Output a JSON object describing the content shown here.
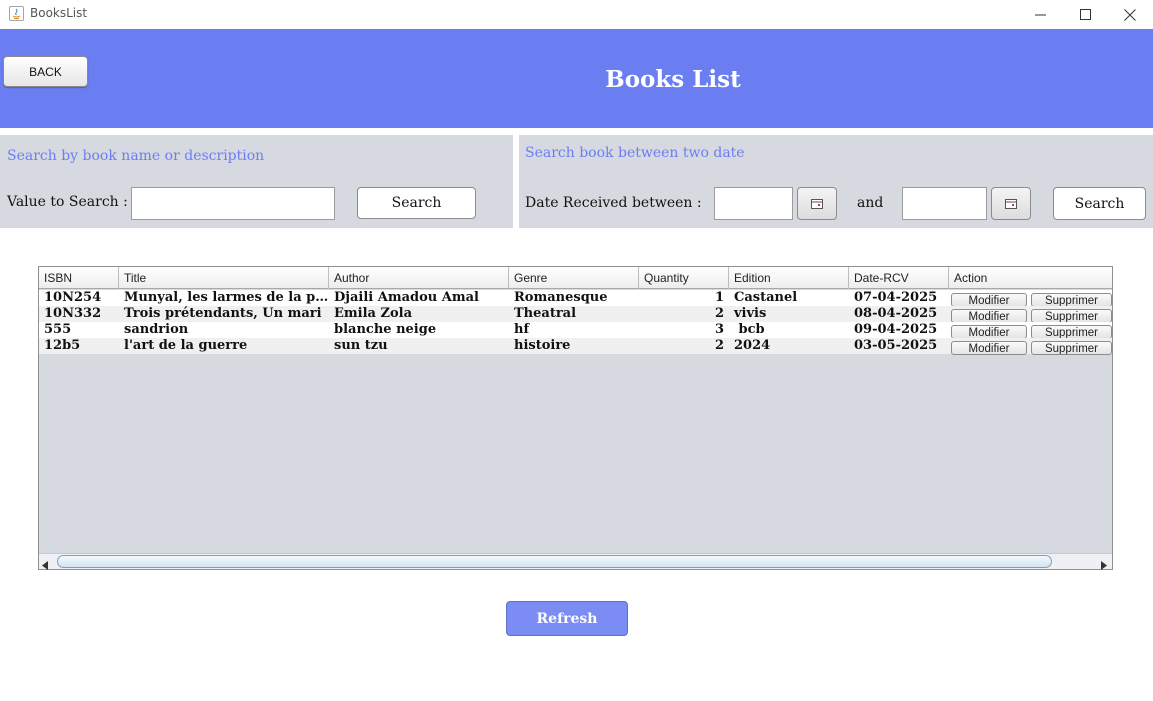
{
  "window": {
    "title": "BooksList"
  },
  "header": {
    "back_label": "BACK",
    "title": "Books List",
    "bg_color": "#6a7ef2"
  },
  "search_name": {
    "title": "Search by book name or description",
    "label": "Value to Search :",
    "value": "",
    "button": "Search"
  },
  "search_date": {
    "title": "Search book between two date",
    "label": "Date Received between :",
    "from_value": "",
    "and_label": "and",
    "to_value": "",
    "button": "Search"
  },
  "table": {
    "columns": [
      "ISBN",
      "Title",
      "Author",
      "Genre",
      "Quantity",
      "Edition",
      "Date-RCV",
      "Action"
    ],
    "rows": [
      {
        "isbn": "10N254",
        "title": "Munyal, les larmes de la patie...",
        "author": "Djaili Amadou Amal",
        "genre": "Romanesque",
        "quantity": "1",
        "edition": "Castanel",
        "date": "07-04-2025",
        "modify": "Modifier",
        "delete": "Supprimer"
      },
      {
        "isbn": "10N332",
        "title": "Trois prétendants, Un mari",
        "author": "Emila Zola",
        "genre": "Theatral",
        "quantity": "2",
        "edition": "vivis",
        "date": "08-04-2025",
        "modify": "Modifier",
        "delete": "Supprimer"
      },
      {
        "isbn": "555",
        "title": "sandrion",
        "author": "blanche neige",
        "genre": "hf",
        "quantity": "3",
        "edition": " bcb",
        "date": "09-04-2025",
        "modify": "Modifier",
        "delete": "Supprimer"
      },
      {
        "isbn": "12b5",
        "title": "l'art de la guerre",
        "author": "sun tzu",
        "genre": "histoire",
        "quantity": "2",
        "edition": "2024",
        "date": "03-05-2025",
        "modify": "Modifier",
        "delete": "Supprimer"
      }
    ]
  },
  "footer": {
    "refresh_label": "Refresh"
  }
}
